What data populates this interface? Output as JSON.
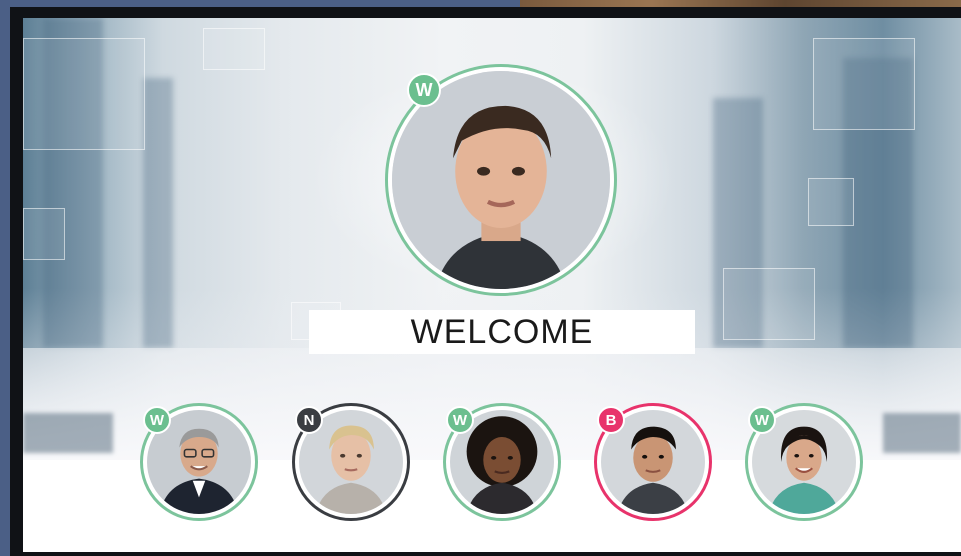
{
  "colors": {
    "w_status": "#6bbf8f",
    "n_status": "#3a3d42",
    "b_status": "#e8336b",
    "ring_green": "#7cc49c",
    "ring_dark": "#3a3d42",
    "ring_red": "#e8336b"
  },
  "welcome": {
    "text": "WELCOME"
  },
  "main_person": {
    "status": "W"
  },
  "people": [
    {
      "status": "W"
    },
    {
      "status": "N"
    },
    {
      "status": "W"
    },
    {
      "status": "B"
    },
    {
      "status": "W"
    }
  ]
}
